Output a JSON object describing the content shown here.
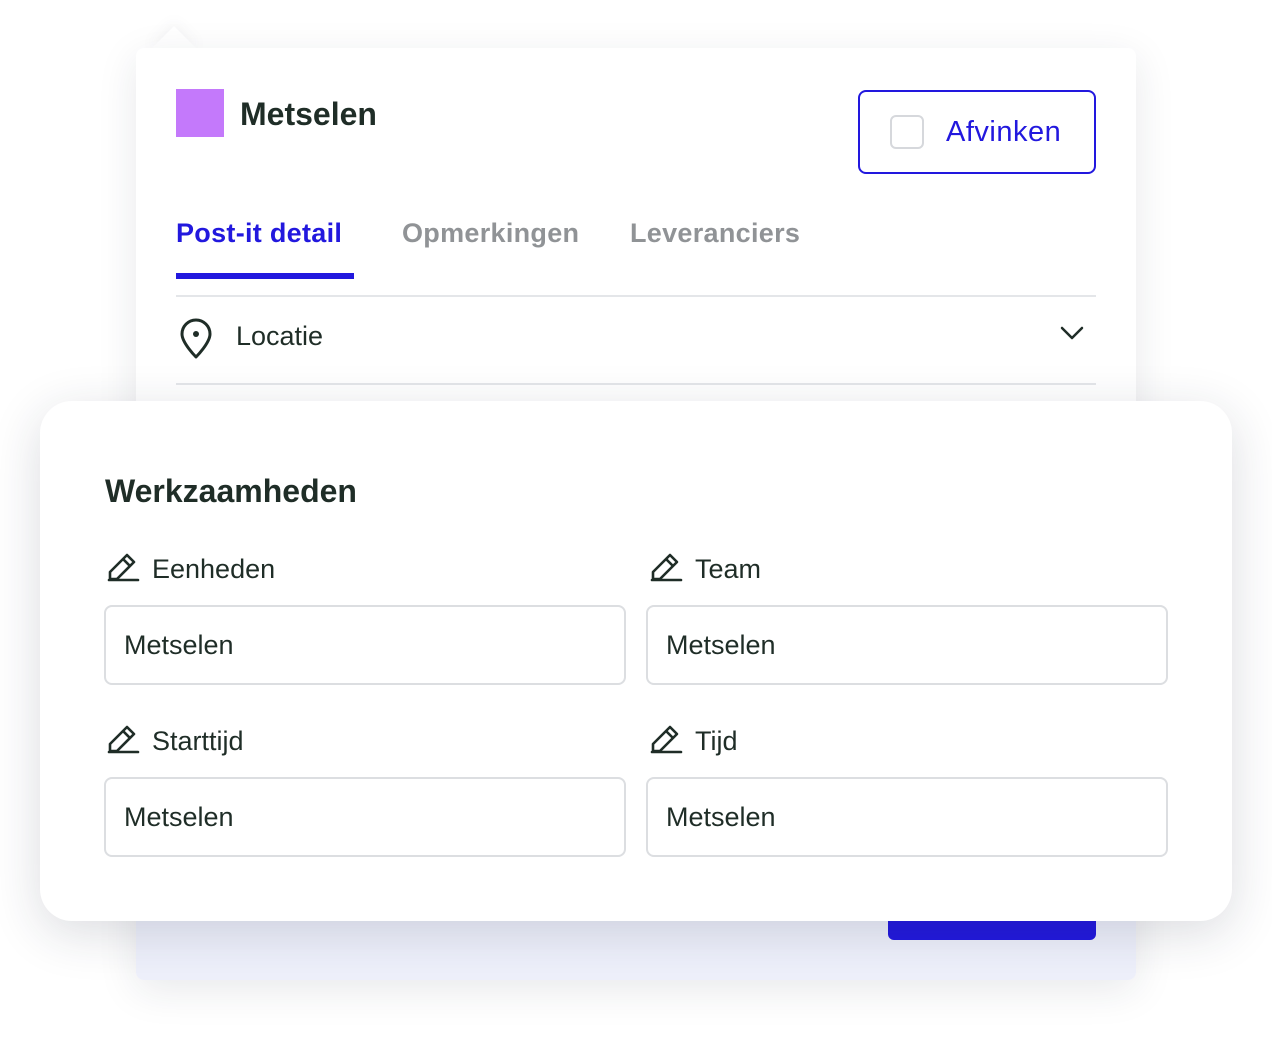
{
  "postit": {
    "title": "Metselen",
    "swatch_color": "#c479fb",
    "check_button_label": "Afvinken",
    "tabs": [
      {
        "label": "Post-it detail",
        "active": true
      },
      {
        "label": "Opmerkingen",
        "active": false
      },
      {
        "label": "Leveranciers",
        "active": false
      }
    ],
    "location_label": "Locatie"
  },
  "werkzaamheden": {
    "title": "Werkzaamheden",
    "fields": [
      {
        "label": "Eenheden",
        "value": "Metselen"
      },
      {
        "label": "Team",
        "value": "Metselen"
      },
      {
        "label": "Starttijd",
        "value": "Metselen"
      },
      {
        "label": "Tijd",
        "value": "Metselen"
      }
    ]
  },
  "colors": {
    "accent": "#2218de",
    "text": "#1f2d27",
    "muted": "#909396",
    "footer_bg": "#eef0fb"
  },
  "icons": {
    "location": "map-pin-icon",
    "expand": "chevron-down-icon",
    "edit": "pencil-icon"
  }
}
